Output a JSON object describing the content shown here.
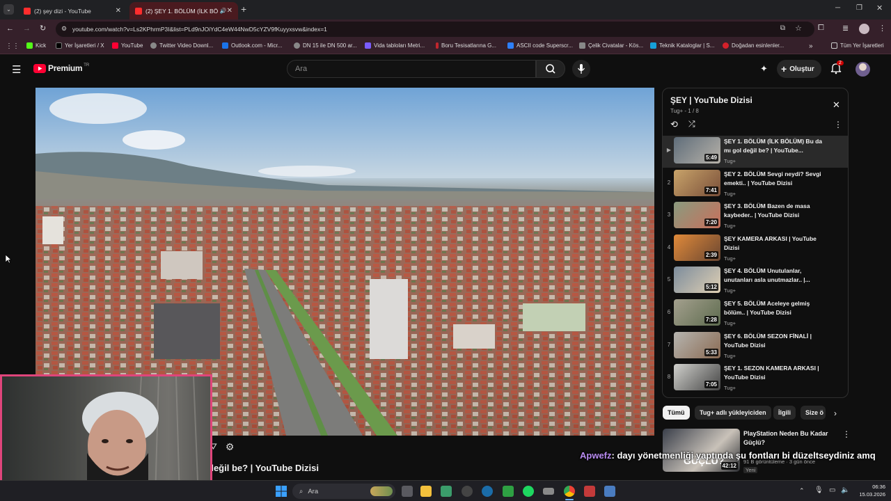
{
  "browser": {
    "tabs": [
      {
        "title": "(2) şey dizi - YouTube"
      },
      {
        "title": "(2) ŞEY 1. BÖLÜM (İLK BÖLÜ"
      }
    ],
    "url": "youtube.com/watch?v=Ls2KPhrmP3I&list=PLd9nJOiYdC4eW44NwD5cYZV9fKuyyxsvw&index=1",
    "bookmarks": [
      "Kick",
      "Yer İşaretleri / X",
      "YouTube",
      "Twitter Video Downl...",
      "Outlook.com - Micr...",
      "DN 15 ile DN 500 ar...",
      "Vida tabloları Metri...",
      "Boru Tesisatlarına G...",
      "ASCII code Superscr...",
      "Çelik Civatalar - Kös...",
      "Teknik Kataloglar | S...",
      "Doğadan esinlenler..."
    ],
    "all_bookmarks": "Tüm Yer İşaretleri"
  },
  "youtube": {
    "logo": "Premium",
    "logo_region": "TR",
    "search_placeholder": "Ara",
    "create_label": "Oluştur",
    "notification_count": "2"
  },
  "video": {
    "title_partial": "değil be? | YouTube Dizisi"
  },
  "playlist": {
    "title": "ŞEY | YouTube Dizisi",
    "meta": "Tug+ - 1 / 8",
    "items": [
      {
        "index": "▶",
        "title": "ŞEY 1. BÖLÜM (İLK BÖLÜM) Bu da mı gol değil be? | YouTube...",
        "channel": "Tug+",
        "duration": "5:49"
      },
      {
        "index": "2",
        "title": "ŞEY 2. BÖLÜM Sevgi neydi? Sevgi emekti.. | YouTube Dizisi",
        "channel": "Tug+",
        "duration": "7:41"
      },
      {
        "index": "3",
        "title": "ŞEY 3. BÖLÜM Bazen de masa kaybeder.. | YouTube Dizisi",
        "channel": "Tug+",
        "duration": "7:20"
      },
      {
        "index": "4",
        "title": "ŞEY KAMERA ARKASI | YouTube Dizisi",
        "channel": "Tug+",
        "duration": "2:39"
      },
      {
        "index": "5",
        "title": "ŞEY 4. BÖLÜM Unutulanlar, unutanları asla unutmazlar.. |...",
        "channel": "Tug+",
        "duration": "5:12"
      },
      {
        "index": "6",
        "title": "ŞEY 5. BÖLÜM Aceleye gelmiş bölüm.. | YouTube Dizisi",
        "channel": "Tug+",
        "duration": "7:28"
      },
      {
        "index": "7",
        "title": "ŞEY 6. BÖLÜM SEZON FİNALİ | YouTube Dizisi",
        "channel": "Tug+",
        "duration": "5:33"
      },
      {
        "index": "8",
        "title": "ŞEY 1. SEZON KAMERA ARKASI | YouTube Dizisi",
        "channel": "Tug+",
        "duration": "7:05"
      }
    ]
  },
  "chips": [
    "Tümü",
    "Tug+ adlı yükleyiciden",
    "İlgili",
    "Size ö"
  ],
  "recommended": {
    "title": "PlayStation Neden Bu Kadar Güçlü?",
    "meta": "91 B görüntüleme · 3 gün önce",
    "badge": "Yeni",
    "duration": "42:12",
    "thumb_text": "GÜÇLÜ?"
  },
  "stream_chat": {
    "user": "Apwefz",
    "message": ": dayı yönetmenliği yaptında şu fontları bi düzeltseydiniz amq"
  },
  "taskbar": {
    "search": "Ara",
    "time": "06:36",
    "date": "15.03.2026"
  },
  "colors": {
    "yt_red": "#ff0033",
    "chat_user": "#b98cf2",
    "webcam_border": "#e0457b"
  }
}
